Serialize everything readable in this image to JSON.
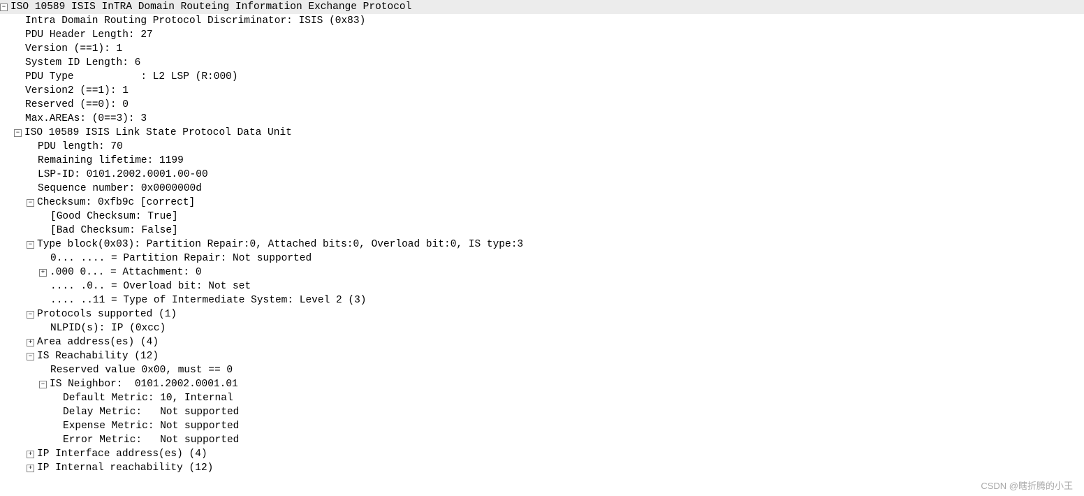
{
  "lines": [
    {
      "indent": 0,
      "toggle": "minus",
      "text": "ISO 10589 ISIS InTRA Domain Routeing Information Exchange Protocol",
      "header": true,
      "name": "proto-root"
    },
    {
      "indent": 36,
      "toggle": null,
      "text": "Intra Domain Routing Protocol Discriminator: ISIS (0x83)",
      "name": "field-discriminator"
    },
    {
      "indent": 36,
      "toggle": null,
      "text": "PDU Header Length: 27",
      "name": "field-pdu-header-length"
    },
    {
      "indent": 36,
      "toggle": null,
      "text": "Version (==1): 1",
      "name": "field-version"
    },
    {
      "indent": 36,
      "toggle": null,
      "text": "System ID Length: 6",
      "name": "field-system-id-length"
    },
    {
      "indent": 36,
      "toggle": null,
      "text": "PDU Type           : L2 LSP (R:000)",
      "name": "field-pdu-type"
    },
    {
      "indent": 36,
      "toggle": null,
      "text": "Version2 (==1): 1",
      "name": "field-version2"
    },
    {
      "indent": 36,
      "toggle": null,
      "text": "Reserved (==0): 0",
      "name": "field-reserved"
    },
    {
      "indent": 36,
      "toggle": null,
      "text": "Max.AREAs: (0==3): 3",
      "name": "field-max-areas"
    },
    {
      "indent": 20,
      "toggle": "minus",
      "text": "ISO 10589 ISIS Link State Protocol Data Unit",
      "name": "node-lsp-data-unit"
    },
    {
      "indent": 54,
      "toggle": null,
      "text": "PDU length: 70",
      "name": "field-pdu-length"
    },
    {
      "indent": 54,
      "toggle": null,
      "text": "Remaining lifetime: 1199",
      "name": "field-remaining-lifetime"
    },
    {
      "indent": 54,
      "toggle": null,
      "text": "LSP-ID: 0101.2002.0001.00-00",
      "name": "field-lsp-id"
    },
    {
      "indent": 54,
      "toggle": null,
      "text": "Sequence number: 0x0000000d",
      "name": "field-sequence-number"
    },
    {
      "indent": 38,
      "toggle": "minus",
      "text": "Checksum: 0xfb9c [correct]",
      "name": "node-checksum"
    },
    {
      "indent": 72,
      "toggle": null,
      "text": "[Good Checksum: True]",
      "name": "field-good-checksum"
    },
    {
      "indent": 72,
      "toggle": null,
      "text": "[Bad Checksum: False]",
      "name": "field-bad-checksum"
    },
    {
      "indent": 38,
      "toggle": "minus",
      "text": "Type block(0x03): Partition Repair:0, Attached bits:0, Overload bit:0, IS type:3",
      "name": "node-type-block"
    },
    {
      "indent": 72,
      "toggle": null,
      "text": "0... .... = Partition Repair: Not supported",
      "name": "field-partition-repair"
    },
    {
      "indent": 56,
      "toggle": "plus",
      "text": ".000 0... = Attachment: 0",
      "name": "node-attachment"
    },
    {
      "indent": 72,
      "toggle": null,
      "text": ".... .0.. = Overload bit: Not set",
      "name": "field-overload-bit"
    },
    {
      "indent": 72,
      "toggle": null,
      "text": ".... ..11 = Type of Intermediate System: Level 2 (3)",
      "name": "field-is-type"
    },
    {
      "indent": 38,
      "toggle": "minus",
      "text": "Protocols supported (1)",
      "name": "node-protocols-supported"
    },
    {
      "indent": 72,
      "toggle": null,
      "text": "NLPID(s): IP (0xcc)",
      "name": "field-nlpid"
    },
    {
      "indent": 38,
      "toggle": "plus",
      "text": "Area address(es) (4)",
      "name": "node-area-addresses"
    },
    {
      "indent": 38,
      "toggle": "minus",
      "text": "IS Reachability (12)",
      "name": "node-is-reachability"
    },
    {
      "indent": 72,
      "toggle": null,
      "text": "Reserved value 0x00, must == 0",
      "name": "field-reserved-value"
    },
    {
      "indent": 56,
      "toggle": "minus",
      "text": "IS Neighbor:  0101.2002.0001.01",
      "name": "node-is-neighbor"
    },
    {
      "indent": 90,
      "toggle": null,
      "text": "Default Metric: 10, Internal",
      "name": "field-default-metric"
    },
    {
      "indent": 90,
      "toggle": null,
      "text": "Delay Metric:   Not supported",
      "name": "field-delay-metric"
    },
    {
      "indent": 90,
      "toggle": null,
      "text": "Expense Metric: Not supported",
      "name": "field-expense-metric"
    },
    {
      "indent": 90,
      "toggle": null,
      "text": "Error Metric:   Not supported",
      "name": "field-error-metric"
    },
    {
      "indent": 38,
      "toggle": "plus",
      "text": "IP Interface address(es) (4)",
      "name": "node-ip-interface-addresses"
    },
    {
      "indent": 38,
      "toggle": "plus",
      "text": "IP Internal reachability (12)",
      "name": "node-ip-internal-reachability"
    }
  ],
  "watermark": "CSDN @瞎折腾的小王"
}
